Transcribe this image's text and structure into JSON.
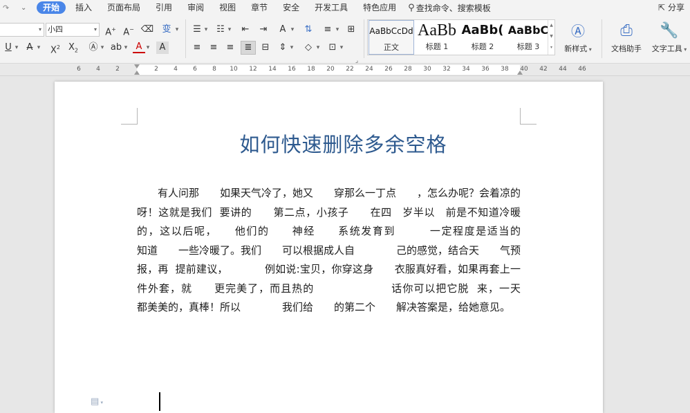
{
  "menubar": {
    "tabs": [
      "开始",
      "插入",
      "页面布局",
      "引用",
      "审阅",
      "视图",
      "章节",
      "安全",
      "开发工具",
      "特色应用"
    ],
    "active_tab": "开始",
    "search_placeholder": "查找命令、搜索模板",
    "share_label": "分享"
  },
  "ribbon": {
    "font_size": "小四",
    "styles": [
      {
        "sample": "AaBbCcDd",
        "label": "正文"
      },
      {
        "sample": "AaBb",
        "label": "标题 1"
      },
      {
        "sample": "AaBb(",
        "label": "标题 2"
      },
      {
        "sample": "AaBbC",
        "label": "标题 3"
      }
    ],
    "new_style_label": "新样式",
    "doc_assistant_label": "文档助手",
    "text_tools_label": "文字工具"
  },
  "ruler": {
    "ticks": [
      "6",
      "4",
      "2",
      "2",
      "4",
      "6",
      "8",
      "10",
      "12",
      "14",
      "16",
      "18",
      "20",
      "22",
      "24",
      "26",
      "28",
      "30",
      "32",
      "34",
      "36",
      "38",
      "40",
      "42",
      "44",
      "46"
    ]
  },
  "document": {
    "title": "如何快速删除多余空格",
    "body": "　　有人问那　　如果天气冷了，她又　　穿那么一丁点　　，怎么办呢？会着凉的呀！这就是我们  要讲的　　第二点，小孩子　　在四　岁半以　前是不知道冷暖的，这以后呢，　　他们的　　神经　　系统发育到　　　一定程度是适当的　　　知道　　一些冷暖了。我们　　可以根据成人自　　　　己的感觉，结合天　　气预报，再  提前建议，　　　　例如说:宝贝，你穿这身　　衣服真好看，如果再套上一件外套，就　　更完美了，而且热的　　　　　　　话你可以把它脱  来，一天　　　都美美的，真棒！所以　　　　我们给　　的第二个　　解决答案是，给她意见。"
  },
  "colors": {
    "accent": "#4a86e8",
    "title_color": "#2e5a8f"
  }
}
